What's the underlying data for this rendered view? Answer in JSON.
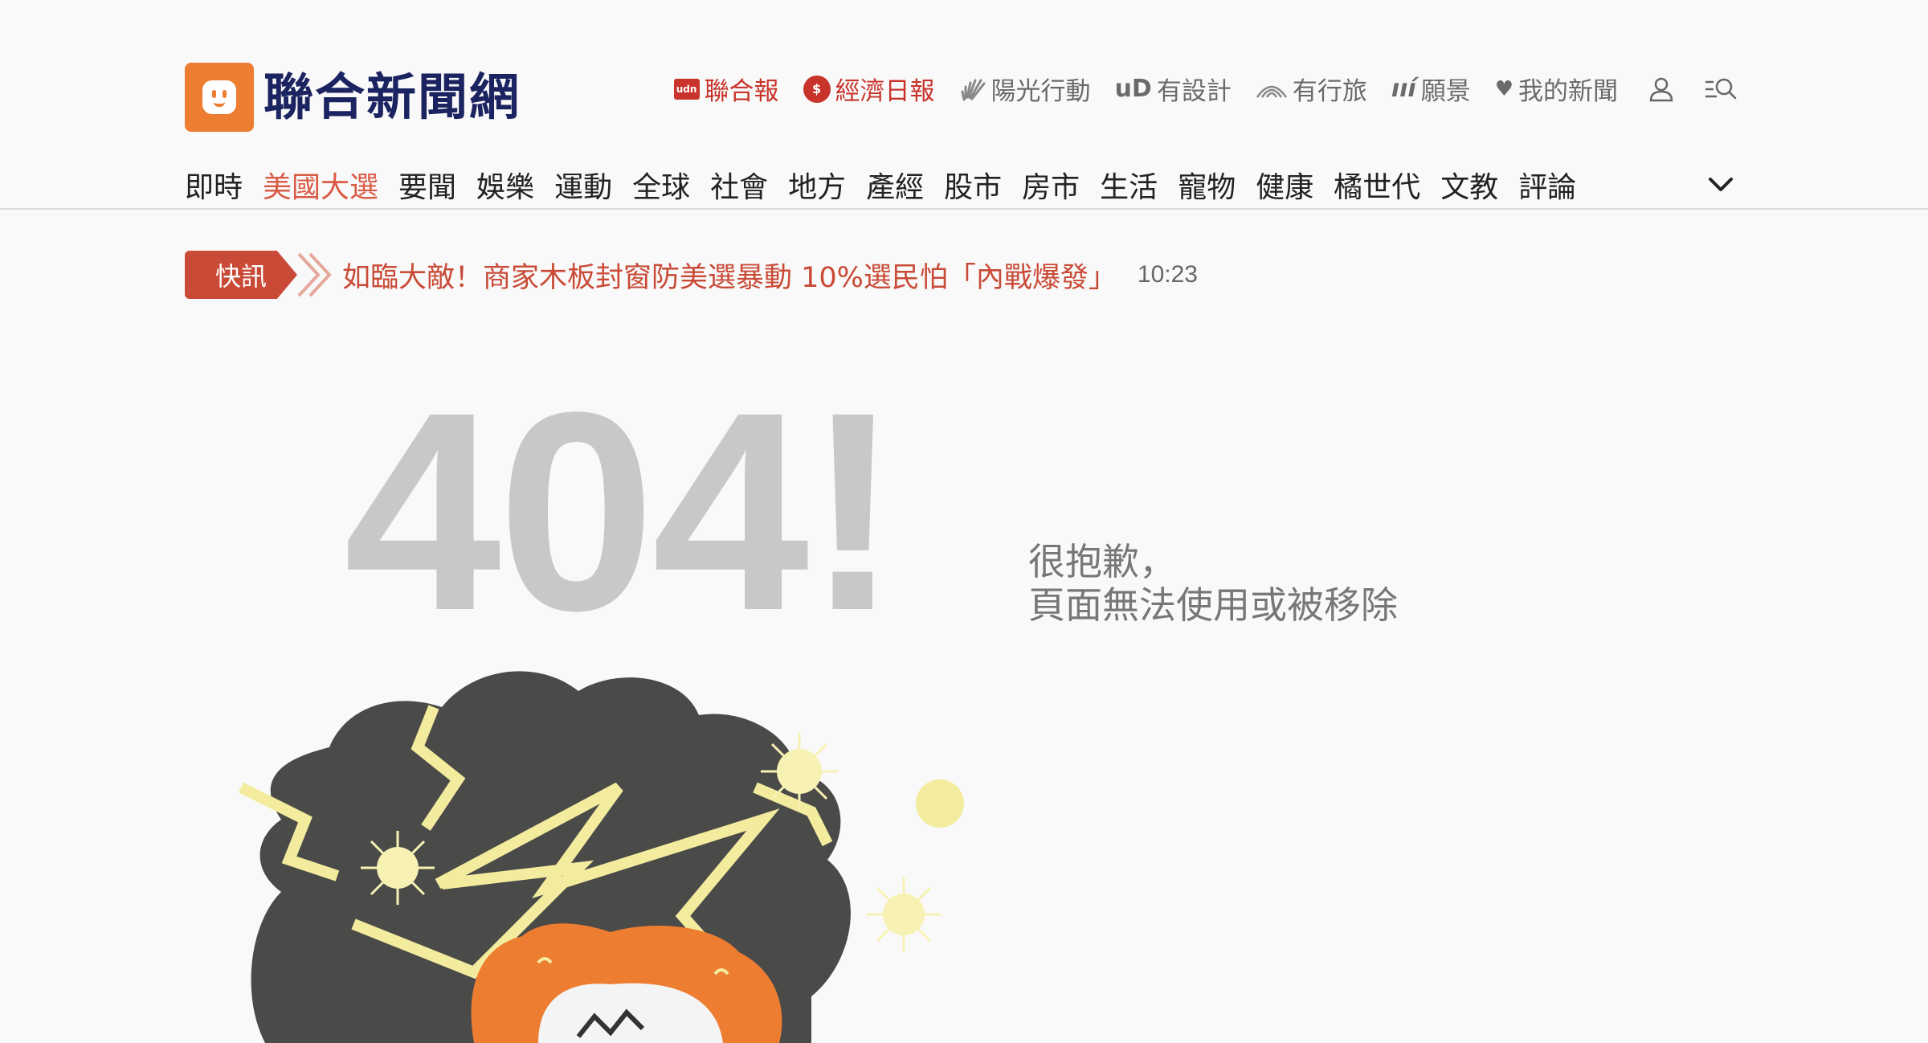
{
  "header": {
    "logo_text": "聯合新聞網",
    "brands": [
      {
        "label": "聯合報",
        "icon": "udn-daily-icon",
        "color": "#c8332b"
      },
      {
        "label": "經濟日報",
        "icon": "money-udn-icon",
        "color": "#c8332b"
      },
      {
        "label": "陽光行動",
        "icon": "sunshine-icon",
        "color": "#6a6a6a"
      },
      {
        "label": "有設計",
        "icon": "ud-icon",
        "icon_text": "uD",
        "color": "#6a6a6a"
      },
      {
        "label": "有行旅",
        "icon": "travel-road-icon",
        "color": "#6a6a6a"
      },
      {
        "label": "願景",
        "icon": "vision-icon",
        "icon_text": "ııí",
        "color": "#6a6a6a"
      },
      {
        "label": "我的新聞",
        "icon": "heart-icon",
        "color": "#6a6a6a"
      }
    ]
  },
  "nav": {
    "items": [
      "即時",
      "美國大選",
      "要聞",
      "娛樂",
      "運動",
      "全球",
      "社會",
      "地方",
      "產經",
      "股市",
      "房市",
      "生活",
      "寵物",
      "健康",
      "橘世代",
      "文教",
      "評論"
    ],
    "active": "美國大選",
    "active_color": "#d95a45"
  },
  "ticker": {
    "badge": "快訊",
    "headline": "如臨大敵！商家木板封窗防美選暴動 10%選民怕「內戰爆發」",
    "time": "10:23",
    "color": "#c94a36"
  },
  "error": {
    "code": "404!",
    "message_line1": "很抱歉，",
    "message_line2": "頁面無法使用或被移除"
  }
}
